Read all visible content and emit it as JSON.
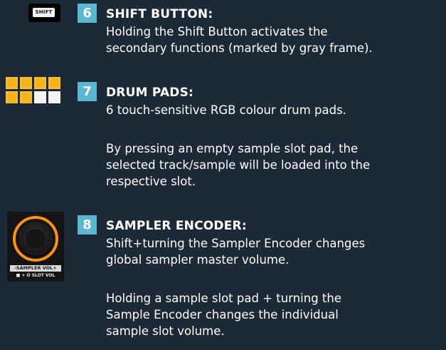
{
  "entries": [
    {
      "number": "6",
      "title": "SHIFT BUTTON:",
      "icon_name": "shift-button-icon",
      "icon_text": "SHIFT",
      "paragraphs": [
        [
          "Holding the Shift Button activates the",
          "secondary functions (marked by gray frame)."
        ]
      ]
    },
    {
      "number": "7",
      "title": "DRUM PADS:",
      "icon_name": "drum-pads-icon",
      "paragraphs": [
        [
          "6 touch-sensitive RGB colour drum pads."
        ],
        [
          "By pressing an empty sample slot pad, the",
          "selected track/sample will be loaded into the",
          "respective slot."
        ]
      ]
    },
    {
      "number": "8",
      "title": "SAMPLER ENCODER:",
      "icon_name": "sampler-encoder-icon",
      "icon_label_1": "-SAMPLER VOL+",
      "icon_label_2": "■ + O SLOT VOL",
      "paragraphs": [
        [
          "Shift+turning the Sampler Encoder changes",
          "global sampler master volume."
        ],
        [
          "Holding a sample slot pad + turning the",
          "Sample Encoder changes the individual",
          "sample slot volume."
        ]
      ]
    }
  ],
  "colors": {
    "background": "#1c2a38",
    "badge": "#5ab7d1",
    "pad_lit": "#f4b31a",
    "pad_unlit": "#f2f2f2",
    "encoder_ring": "#ff8a00"
  }
}
